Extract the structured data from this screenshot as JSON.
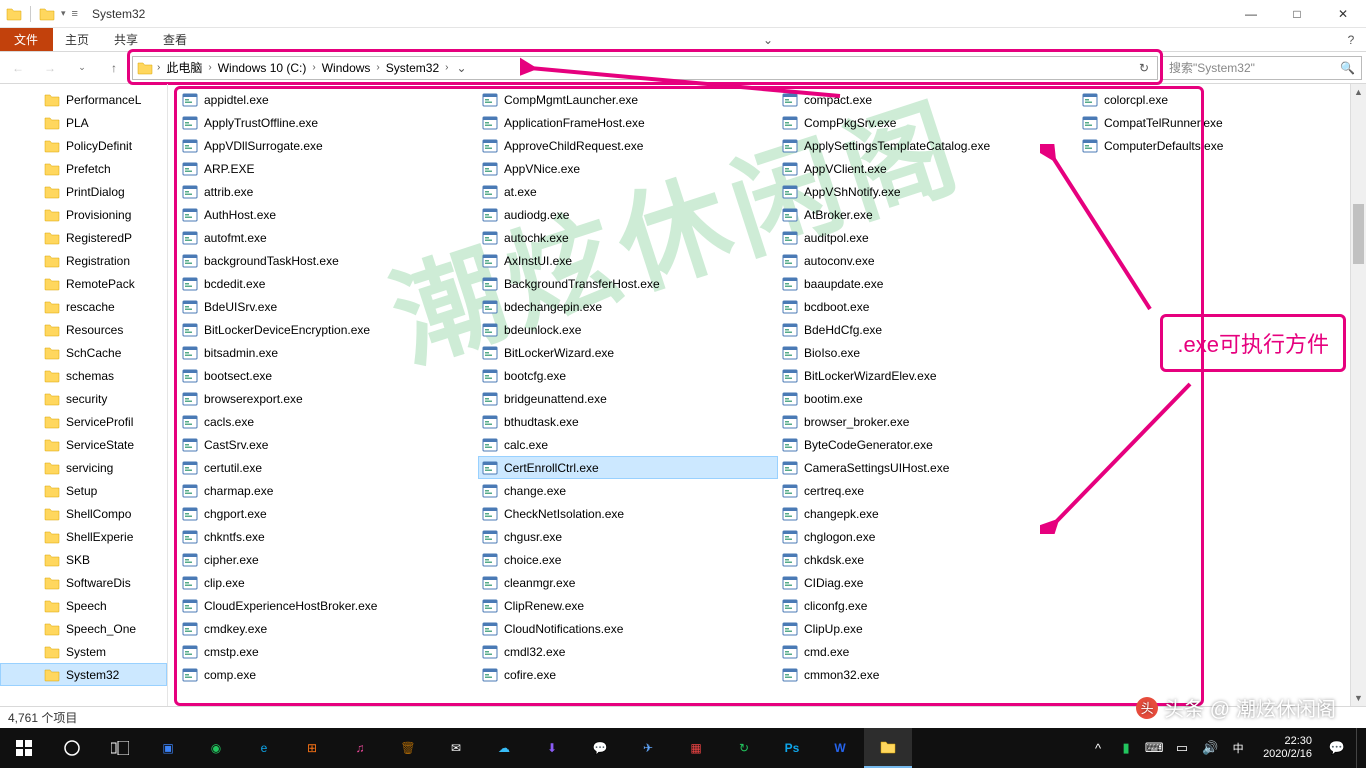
{
  "window": {
    "title": "System32",
    "min": "—",
    "max": "□",
    "close": "✕"
  },
  "ribbon": {
    "file": "文件",
    "home": "主页",
    "share": "共享",
    "view": "查看",
    "expand": "⌄",
    "help": "?"
  },
  "nav": {
    "back": "←",
    "fwd": "→",
    "down": "⌄",
    "up": "↑",
    "crumbs": [
      "此电脑",
      "Windows 10 (C:)",
      "Windows",
      "System32"
    ],
    "drop": "⌄",
    "refresh": "↻"
  },
  "search": {
    "placeholder": "搜索\"System32\""
  },
  "tree": [
    "PerformanceL",
    "PLA",
    "PolicyDefinit",
    "Prefetch",
    "PrintDialog",
    "Provisioning",
    "RegisteredP",
    "Registration",
    "RemotePack",
    "rescache",
    "Resources",
    "SchCache",
    "schemas",
    "security",
    "ServiceProfil",
    "ServiceState",
    "servicing",
    "Setup",
    "ShellCompo",
    "ShellExperie",
    "SKB",
    "SoftwareDis",
    "Speech",
    "Speech_One",
    "System",
    "System32"
  ],
  "selectedTree": "System32",
  "files": [
    "appidtel.exe",
    "ApplyTrustOffline.exe",
    "AppVDllSurrogate.exe",
    "ARP.EXE",
    "attrib.exe",
    "AuthHost.exe",
    "autofmt.exe",
    "backgroundTaskHost.exe",
    "bcdedit.exe",
    "BdeUISrv.exe",
    "BitLockerDeviceEncryption.exe",
    "bitsadmin.exe",
    "bootsect.exe",
    "browserexport.exe",
    "cacls.exe",
    "CastSrv.exe",
    "certutil.exe",
    "charmap.exe",
    "chgport.exe",
    "chkntfs.exe",
    "cipher.exe",
    "clip.exe",
    "CloudExperienceHostBroker.exe",
    "cmdkey.exe",
    "cmstp.exe",
    "comp.exe",
    "CompMgmtLauncher.exe",
    "ApplicationFrameHost.exe",
    "ApproveChildRequest.exe",
    "AppVNice.exe",
    "at.exe",
    "audiodg.exe",
    "autochk.exe",
    "AxInstUI.exe",
    "BackgroundTransferHost.exe",
    "bdechangepin.exe",
    "bdeunlock.exe",
    "BitLockerWizard.exe",
    "bootcfg.exe",
    "bridgeunattend.exe",
    "bthudtask.exe",
    "calc.exe",
    "CertEnrollCtrl.exe",
    "change.exe",
    "CheckNetIsolation.exe",
    "chgusr.exe",
    "choice.exe",
    "cleanmgr.exe",
    "ClipRenew.exe",
    "CloudNotifications.exe",
    "cmdl32.exe",
    "cofire.exe",
    "compact.exe",
    "CompPkgSrv.exe",
    "ApplySettingsTemplateCatalog.exe",
    "AppVClient.exe",
    "AppVShNotify.exe",
    "AtBroker.exe",
    "auditpol.exe",
    "autoconv.exe",
    "baaupdate.exe",
    "bcdboot.exe",
    "BdeHdCfg.exe",
    "BioIso.exe",
    "BitLockerWizardElev.exe",
    "bootim.exe",
    "browser_broker.exe",
    "ByteCodeGenerator.exe",
    "CameraSettingsUIHost.exe",
    "certreq.exe",
    "changepk.exe",
    "chglogon.exe",
    "chkdsk.exe",
    "CIDiag.exe",
    "cliconfg.exe",
    "ClipUp.exe",
    "cmd.exe",
    "cmmon32.exe",
    "colorcpl.exe",
    "CompatTelRunner.exe",
    "ComputerDefaults.exe"
  ],
  "selectedFile": "CertEnrollCtrl.exe",
  "status": {
    "count": "4,761 个项目"
  },
  "annotation": {
    "label": ".exe可执行方件"
  },
  "watermark": "潮炫休闲阁",
  "credit": {
    "prefix": "头条 @",
    "name": "潮炫休闲阁"
  },
  "clock": {
    "time": "22:30",
    "date": "2020/2/16"
  }
}
